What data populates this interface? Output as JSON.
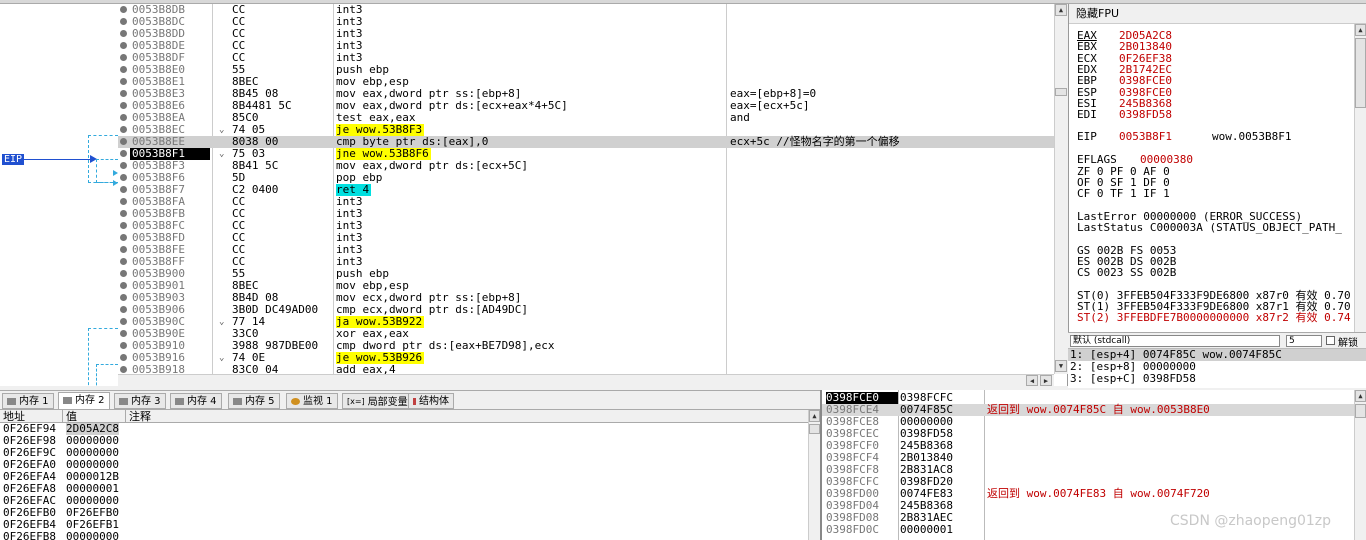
{
  "disasm": {
    "rows": [
      {
        "addr": "0053B8DB",
        "bytes": "CC",
        "asm": "int3",
        "cmt": ""
      },
      {
        "addr": "0053B8DC",
        "bytes": "CC",
        "asm": "int3",
        "cmt": ""
      },
      {
        "addr": "0053B8DD",
        "bytes": "CC",
        "asm": "int3",
        "cmt": ""
      },
      {
        "addr": "0053B8DE",
        "bytes": "CC",
        "asm": "int3",
        "cmt": ""
      },
      {
        "addr": "0053B8DF",
        "bytes": "CC",
        "asm": "int3",
        "cmt": ""
      },
      {
        "addr": "0053B8E0",
        "bytes": "55",
        "asm": "push ebp",
        "cmt": ""
      },
      {
        "addr": "0053B8E1",
        "bytes": "8BEC",
        "asm": "mov ebp,esp",
        "cmt": ""
      },
      {
        "addr": "0053B8E3",
        "bytes": "8B45 08",
        "asm": "mov eax,dword ptr ss:[ebp+8]",
        "cmt": "eax=[ebp+8]=0"
      },
      {
        "addr": "0053B8E6",
        "bytes": "8B4481 5C",
        "asm": "mov eax,dword ptr ds:[ecx+eax*4+5C]",
        "cmt": "eax=[ecx+5c]"
      },
      {
        "addr": "0053B8EA",
        "bytes": "85C0",
        "asm": "test eax,eax",
        "cmt": "and"
      },
      {
        "addr": "0053B8EC",
        "bytes": "74 05",
        "asm": "je wow.53B8F3",
        "cmt": ""
      },
      {
        "addr": "0053B8EE",
        "bytes": "8038 00",
        "asm": "cmp byte ptr ds:[eax],0",
        "cmt": "ecx+5c //怪物名字的第一个偏移"
      },
      {
        "addr": "0053B8F1",
        "bytes": "75 03",
        "asm": "jne wow.53B8F6",
        "cmt": ""
      },
      {
        "addr": "0053B8F3",
        "bytes": "8B41 5C",
        "asm": "mov eax,dword ptr ds:[ecx+5C]",
        "cmt": ""
      },
      {
        "addr": "0053B8F6",
        "bytes": "5D",
        "asm": "pop ebp",
        "cmt": ""
      },
      {
        "addr": "0053B8F7",
        "bytes": "C2 0400",
        "asm": "ret 4",
        "cmt": ""
      },
      {
        "addr": "0053B8FA",
        "bytes": "CC",
        "asm": "int3",
        "cmt": ""
      },
      {
        "addr": "0053B8FB",
        "bytes": "CC",
        "asm": "int3",
        "cmt": ""
      },
      {
        "addr": "0053B8FC",
        "bytes": "CC",
        "asm": "int3",
        "cmt": ""
      },
      {
        "addr": "0053B8FD",
        "bytes": "CC",
        "asm": "int3",
        "cmt": ""
      },
      {
        "addr": "0053B8FE",
        "bytes": "CC",
        "asm": "int3",
        "cmt": ""
      },
      {
        "addr": "0053B8FF",
        "bytes": "CC",
        "asm": "int3",
        "cmt": ""
      },
      {
        "addr": "0053B900",
        "bytes": "55",
        "asm": "push ebp",
        "cmt": ""
      },
      {
        "addr": "0053B901",
        "bytes": "8BEC",
        "asm": "mov ebp,esp",
        "cmt": ""
      },
      {
        "addr": "0053B903",
        "bytes": "8B4D 08",
        "asm": "mov ecx,dword ptr ss:[ebp+8]",
        "cmt": ""
      },
      {
        "addr": "0053B906",
        "bytes": "3B0D DC49AD00",
        "asm": "cmp ecx,dword ptr ds:[AD49DC]",
        "cmt": ""
      },
      {
        "addr": "0053B90C",
        "bytes": "77 14",
        "asm": "ja wow.53B922",
        "cmt": ""
      },
      {
        "addr": "0053B90E",
        "bytes": "33C0",
        "asm": "xor eax,eax",
        "cmt": ""
      },
      {
        "addr": "0053B910",
        "bytes": "3988 987DBE00",
        "asm": "cmp dword ptr ds:[eax+BE7D98],ecx",
        "cmt": ""
      },
      {
        "addr": "0053B916",
        "bytes": "74 0E",
        "asm": "je wow.53B926",
        "cmt": ""
      },
      {
        "addr": "0053B918",
        "bytes": "83C0 04",
        "asm": "add eax,4",
        "cmt": ""
      }
    ],
    "eip_label": "EIP"
  },
  "registers": {
    "title": "隐藏FPU",
    "gp": [
      {
        "name": "EAX",
        "value": "2D05A2C8"
      },
      {
        "name": "EBX",
        "value": "2B013840"
      },
      {
        "name": "ECX",
        "value": "0F26EF38"
      },
      {
        "name": "EDX",
        "value": "2B1742EC"
      },
      {
        "name": "EBP",
        "value": "0398FCE0"
      },
      {
        "name": "ESP",
        "value": "0398FCE0"
      },
      {
        "name": "ESI",
        "value": "245B8368"
      },
      {
        "name": "EDI",
        "value": "0398FD58"
      }
    ],
    "eip": {
      "name": "EIP",
      "value": "0053B8F1",
      "sym": "wow.0053B8F1"
    },
    "eflags": {
      "name": "EFLAGS",
      "value": "00000380"
    },
    "flags1": "ZF 0  PF 0  AF 0",
    "flags2": "OF 0  SF 1  DF 0",
    "flags3": "CF 0  TF 1  IF 1",
    "lasterror": "LastError  00000000 (ERROR_SUCCESS)",
    "laststatus": "LastStatus C000003A (STATUS_OBJECT_PATH_",
    "seg1": "GS 002B  FS 0053",
    "seg2": "ES 002B  DS 002B",
    "seg3": "CS 0023  SS 002B",
    "st0": "ST(0) 3FFEB504F333F9DE6800 x87r0 有效 0.70",
    "st1": "ST(1) 3FFEB504F333F9DE6800 x87r1 有效 0.70",
    "st2": "ST(2) 3FFEBDFE7B0000000000 x87r2 有效 0.74"
  },
  "callconv": {
    "selected": "默认 (stdcall)",
    "count": "5",
    "unlock_label": "解锁"
  },
  "args": [
    "1: [esp+4] 0074F85C wow.0074F85C",
    "2: [esp+8] 00000000",
    "3: [esp+C] 0398FD58"
  ],
  "dump": {
    "tabs": [
      "内存 1",
      "内存 2",
      "内存 3",
      "内存 4",
      "内存 5",
      "监视 1",
      "局部变量",
      "结构体"
    ],
    "headers": {
      "addr": "地址",
      "value": "值",
      "comment": "注释"
    },
    "rows": [
      {
        "addr": "0F26EF94",
        "value": "2D05A2C8"
      },
      {
        "addr": "0F26EF98",
        "value": "00000000"
      },
      {
        "addr": "0F26EF9C",
        "value": "00000000"
      },
      {
        "addr": "0F26EFA0",
        "value": "00000000"
      },
      {
        "addr": "0F26EFA4",
        "value": "0000012B"
      },
      {
        "addr": "0F26EFA8",
        "value": "00000001"
      },
      {
        "addr": "0F26EFAC",
        "value": "00000000"
      },
      {
        "addr": "0F26EFB0",
        "value": "0F26EFB0"
      },
      {
        "addr": "0F26EFB4",
        "value": "0F26EFB1"
      },
      {
        "addr": "0F26EFB8",
        "value": "00000000"
      }
    ]
  },
  "stack": {
    "rows": [
      {
        "addr": "0398FCE0",
        "value": "0398FCFC",
        "cmt": ""
      },
      {
        "addr": "0398FCE4",
        "value": "0074F85C",
        "cmt": "返回到 wow.0074F85C 自 wow.0053B8E0"
      },
      {
        "addr": "0398FCE8",
        "value": "00000000",
        "cmt": ""
      },
      {
        "addr": "0398FCEC",
        "value": "0398FD58",
        "cmt": ""
      },
      {
        "addr": "0398FCF0",
        "value": "245B8368",
        "cmt": ""
      },
      {
        "addr": "0398FCF4",
        "value": "2B013840",
        "cmt": ""
      },
      {
        "addr": "0398FCF8",
        "value": "2B831AC8",
        "cmt": ""
      },
      {
        "addr": "0398FCFC",
        "value": "0398FD20",
        "cmt": ""
      },
      {
        "addr": "0398FD00",
        "value": "0074FE83",
        "cmt": "返回到 wow.0074FE83 自 wow.0074F720"
      },
      {
        "addr": "0398FD04",
        "value": "245B8368",
        "cmt": ""
      },
      {
        "addr": "0398FD08",
        "value": "2B831AEC",
        "cmt": ""
      },
      {
        "addr": "0398FD0C",
        "value": "00000001",
        "cmt": ""
      }
    ]
  },
  "watermark": "CSDN @zhaopeng01zp"
}
